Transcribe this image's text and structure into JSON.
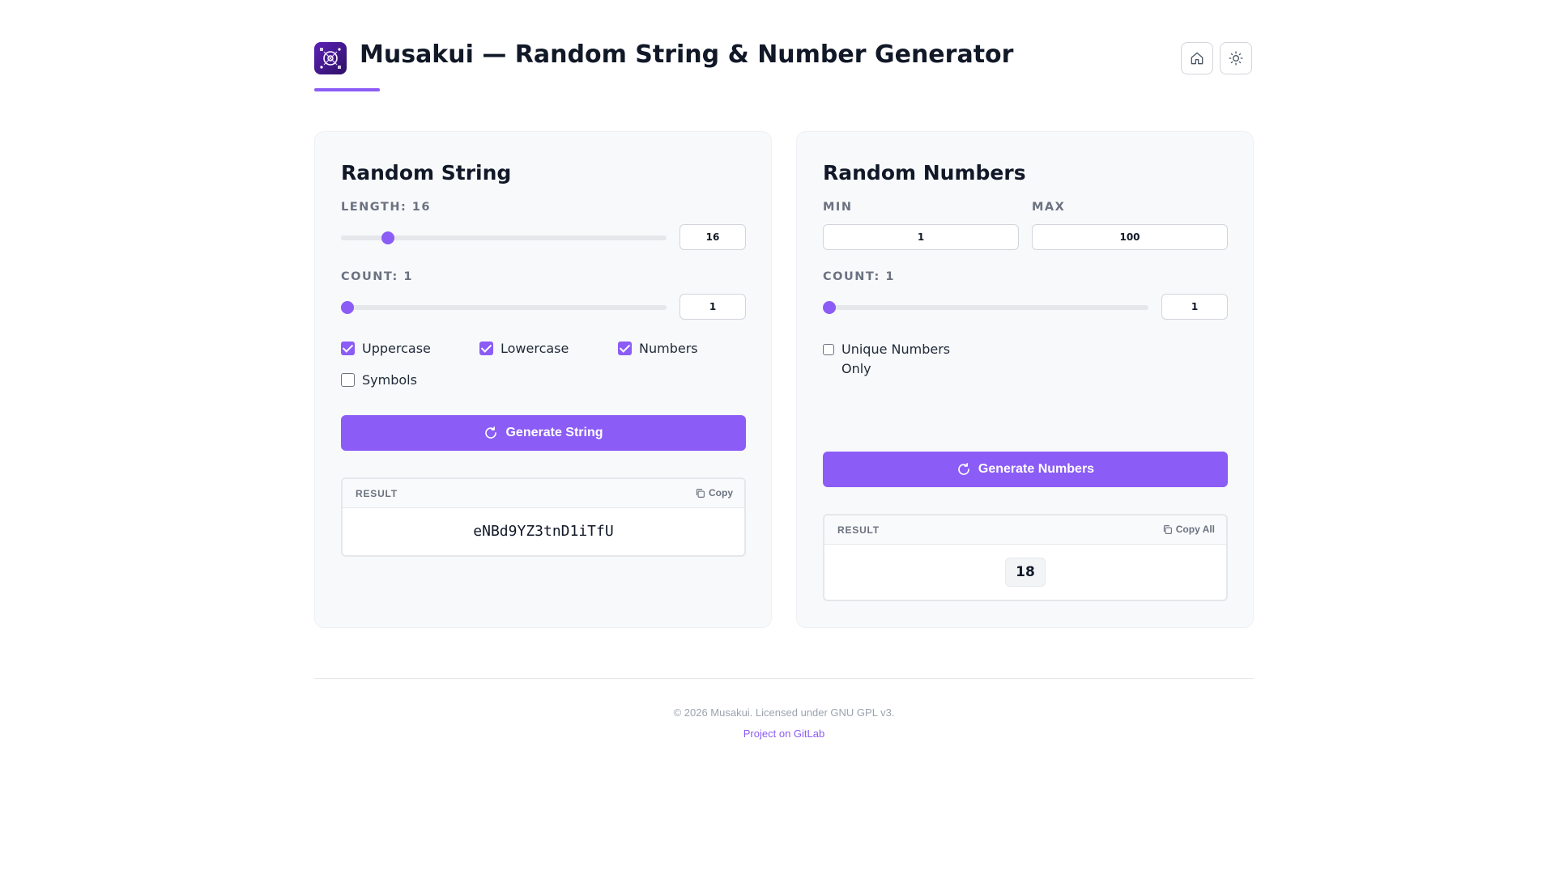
{
  "header": {
    "title": "Musakui — Random String & Number Generator"
  },
  "string_card": {
    "title": "Random String",
    "length_label": "LENGTH: 16",
    "length_value": "16",
    "length_fraction": 0.13,
    "count_label": "COUNT: 1",
    "count_value": "1",
    "count_fraction": 0.0,
    "options": [
      {
        "label": "Uppercase",
        "checked": true
      },
      {
        "label": "Lowercase",
        "checked": true
      },
      {
        "label": "Numbers",
        "checked": true
      },
      {
        "label": "Symbols",
        "checked": false
      }
    ],
    "generate_label": "Generate String",
    "result_label": "RESULT",
    "copy_label": "Copy",
    "result_value": "eNBd9YZ3tnD1iTfU"
  },
  "number_card": {
    "title": "Random Numbers",
    "min_label": "MIN",
    "min_value": "1",
    "max_label": "MAX",
    "max_value": "100",
    "count_label": "COUNT: 1",
    "count_value": "1",
    "count_fraction": 0.0,
    "unique_label_line1": "Unique Numbers",
    "unique_label_line2": "Only",
    "unique_checked": false,
    "generate_label": "Generate Numbers",
    "result_label": "RESULT",
    "copy_label": "Copy All",
    "result_value": "18"
  },
  "footer": {
    "copyright": "© 2026 Musakui. Licensed under GNU GPL v3.",
    "link_text": "Project on GitLab"
  },
  "colors": {
    "accent": "#8b5cf6",
    "background": "#ffffff",
    "card": "#f8f9fb"
  },
  "icons": {
    "logo": "musakui-logo-icon",
    "home": "home-icon",
    "theme": "sun-icon",
    "generate": "refresh-icon",
    "copy": "copy-icon"
  }
}
